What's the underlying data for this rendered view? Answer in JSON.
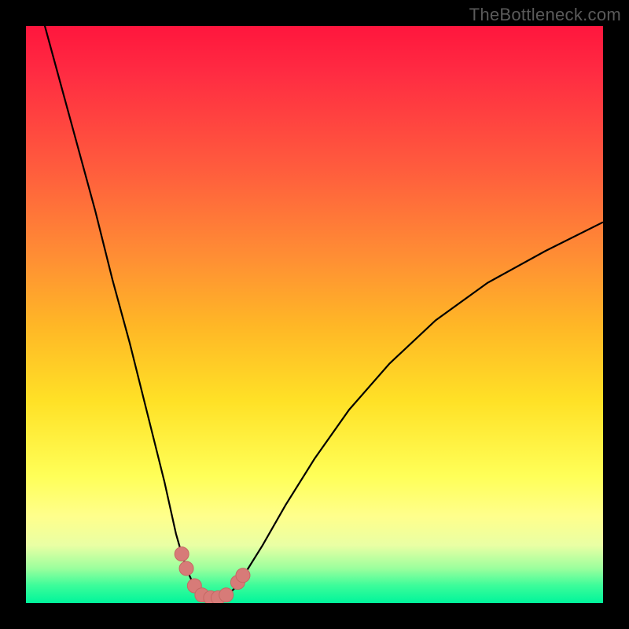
{
  "watermark": "TheBottleneck.com",
  "colors": {
    "frame": "#000000",
    "curve": "#000000",
    "markers_fill": "#d77b78",
    "markers_stroke": "#c66864"
  },
  "chart_data": {
    "type": "line",
    "title": "",
    "xlabel": "",
    "ylabel": "",
    "xlim": [
      0,
      100
    ],
    "ylim": [
      0,
      100
    ],
    "x": [
      0,
      3,
      6,
      9,
      12,
      15,
      18,
      21,
      24,
      26,
      27,
      28,
      29,
      30,
      31,
      32,
      33,
      34,
      35,
      36,
      38,
      41,
      45,
      50,
      56,
      63,
      71,
      80,
      90,
      100
    ],
    "y": [
      112,
      101,
      90,
      79,
      68,
      56,
      45,
      33,
      21,
      12,
      8.5,
      5.5,
      3.3,
      1.8,
      1.0,
      0.8,
      0.8,
      1.0,
      1.5,
      2.4,
      5.2,
      10.0,
      17.0,
      25.0,
      33.5,
      41.5,
      49.0,
      55.5,
      61.0,
      66.0
    ],
    "note": "V-shaped bottleneck curve; values approximate, reading from a green(0%)-to-red(100%) vertical color scale.",
    "markers": [
      {
        "x": 27.0,
        "y": 8.5
      },
      {
        "x": 27.8,
        "y": 6.0
      },
      {
        "x": 29.2,
        "y": 3.0
      },
      {
        "x": 30.5,
        "y": 1.4
      },
      {
        "x": 32.0,
        "y": 0.9
      },
      {
        "x": 33.3,
        "y": 0.9
      },
      {
        "x": 34.7,
        "y": 1.4
      },
      {
        "x": 36.7,
        "y": 3.6
      },
      {
        "x": 37.6,
        "y": 4.8
      }
    ]
  }
}
